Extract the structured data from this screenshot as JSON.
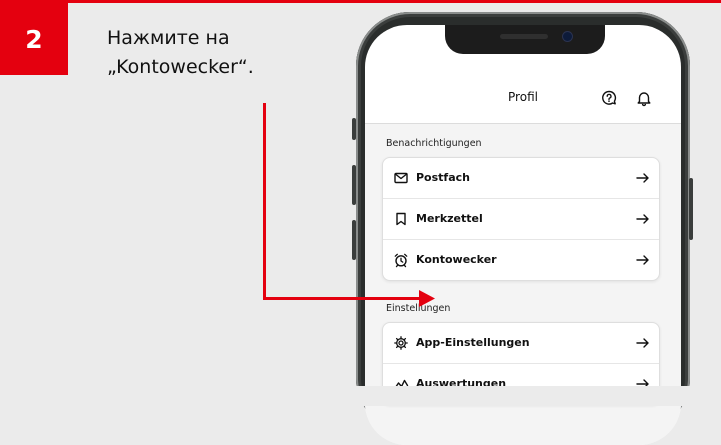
{
  "step": {
    "number": "2"
  },
  "instruction": {
    "line1": "Нажмите на",
    "line2": "„Kontowecker“."
  },
  "app": {
    "header": {
      "title": "Profil",
      "icons": [
        "help-icon",
        "bell-icon"
      ]
    },
    "sections": [
      {
        "title": "Benachrichtigungen",
        "items": [
          {
            "label": "Postfach",
            "icon": "mail-icon"
          },
          {
            "label": "Merkzettel",
            "icon": "bookmark-icon"
          },
          {
            "label": "Kontowecker",
            "icon": "alarm-clock-icon"
          }
        ]
      },
      {
        "title": "Einstellungen",
        "items": [
          {
            "label": "App-Einstellungen",
            "icon": "gear-icon"
          },
          {
            "label": "Auswertungen",
            "icon": "chart-icon"
          }
        ]
      }
    ]
  },
  "colors": {
    "accent": "#e4000f",
    "background": "#ebebeb",
    "phone_frame": "#2a2d2c"
  }
}
